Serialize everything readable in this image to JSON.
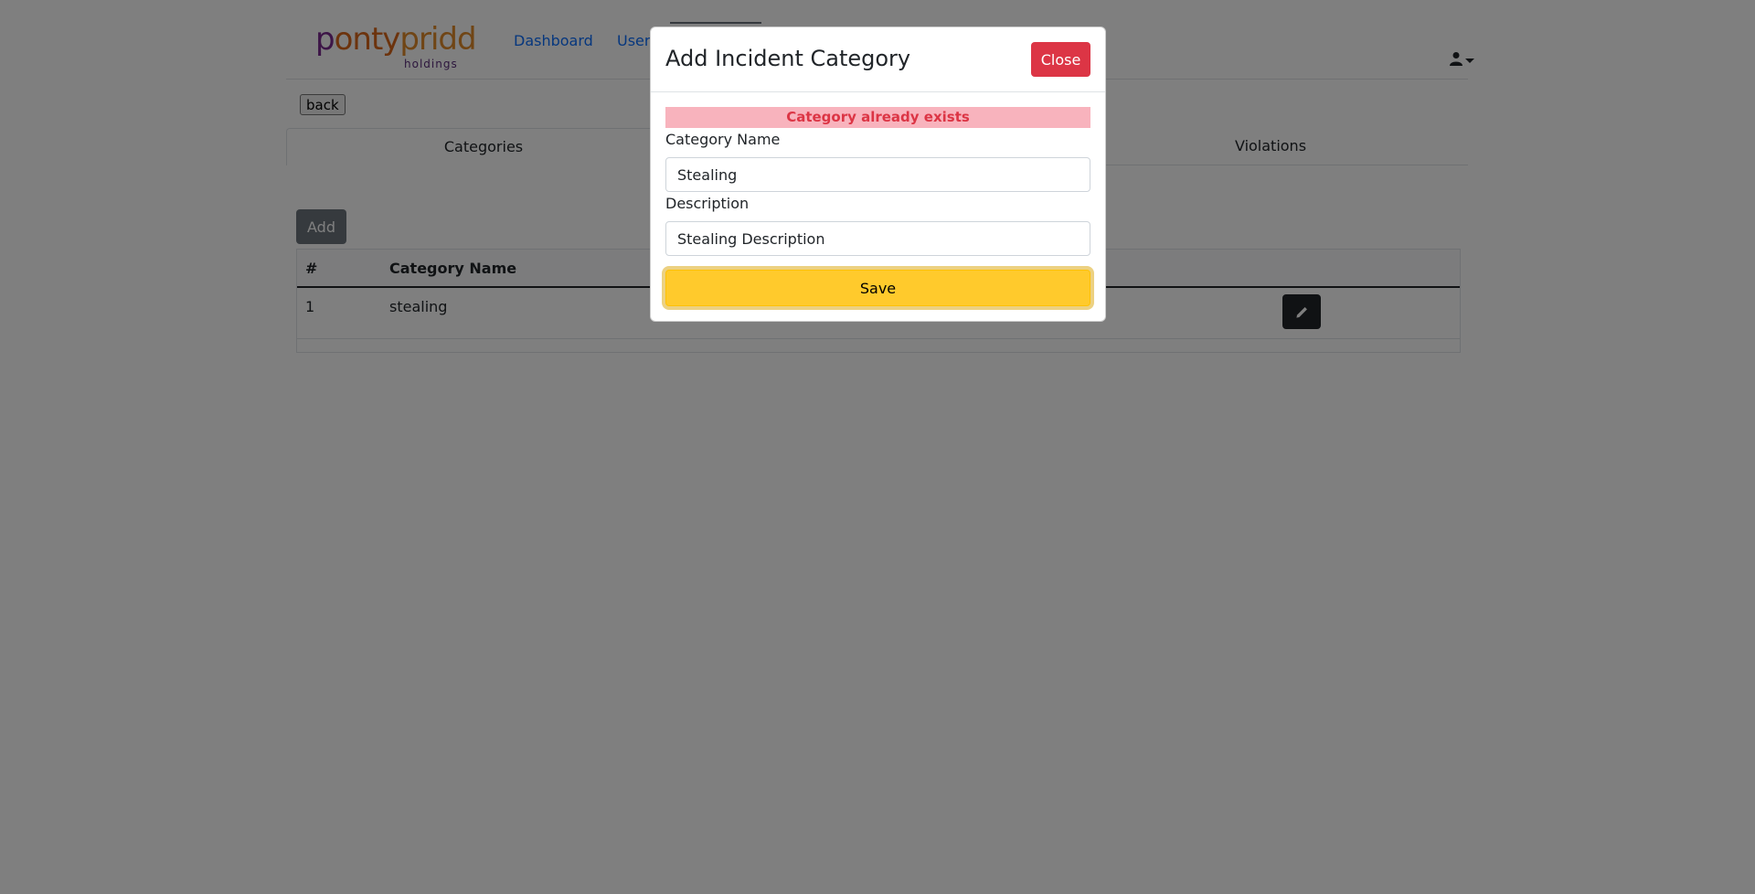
{
  "navbar": {
    "logo_text_part1": "p",
    "logo_text_part2": "onty",
    "logo_text_part3": "pridd",
    "logo_subtext": "holdings",
    "links": [
      "Dashboard",
      "Users"
    ],
    "user_icon": "user-icon"
  },
  "page": {
    "back_label": "back",
    "tabs": [
      "Categories",
      "Violations"
    ],
    "add_label": "Add",
    "table": {
      "headers": [
        "#",
        "Category Name"
      ],
      "rows": [
        {
          "num": "1",
          "name": "stealing"
        }
      ]
    }
  },
  "modal": {
    "title": "Add Incident Category",
    "close_label": "Close",
    "error_message": "Category already exists",
    "category_name_label": "Category Name",
    "category_name_value": "Stealing",
    "description_label": "Description",
    "description_value": "Stealing Description",
    "save_label": "Save"
  },
  "colors": {
    "close_button": "#dc3545",
    "save_button": "#ffca2c",
    "error_background": "#f8b3bd",
    "error_text": "#dc3545",
    "link": "#0d6efd"
  }
}
